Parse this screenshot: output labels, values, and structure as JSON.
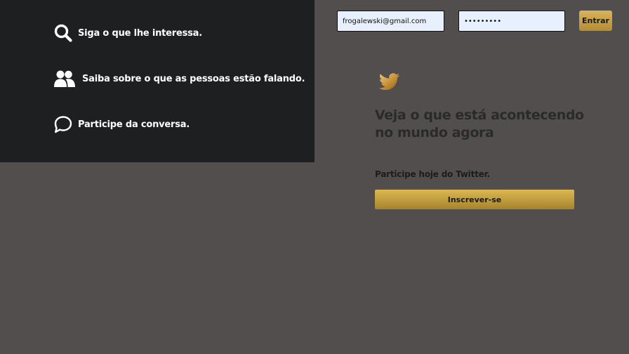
{
  "features": [
    {
      "icon": "search-icon",
      "label": "Siga o que lhe interessa."
    },
    {
      "icon": "people-icon",
      "label": "Saiba sobre o que as pessoas estão falando."
    },
    {
      "icon": "chat-bubble-icon",
      "label": "Participe da conversa."
    }
  ],
  "login": {
    "email_value": "frogalewski@gmail.com",
    "password_value": "•••••••••",
    "submit_label": "Entrar"
  },
  "main": {
    "logo_icon": "bird-logo-icon",
    "headline": "Veja o que está acontecendo no mundo agora",
    "join_text": "Participe hoje do Twitter.",
    "signup_label": "Inscrever-se"
  },
  "colors": {
    "background": "#524e4e",
    "panel": "#1e1f21",
    "accent_gold": "#c9a040",
    "input_fill": "#e8f0fe"
  }
}
